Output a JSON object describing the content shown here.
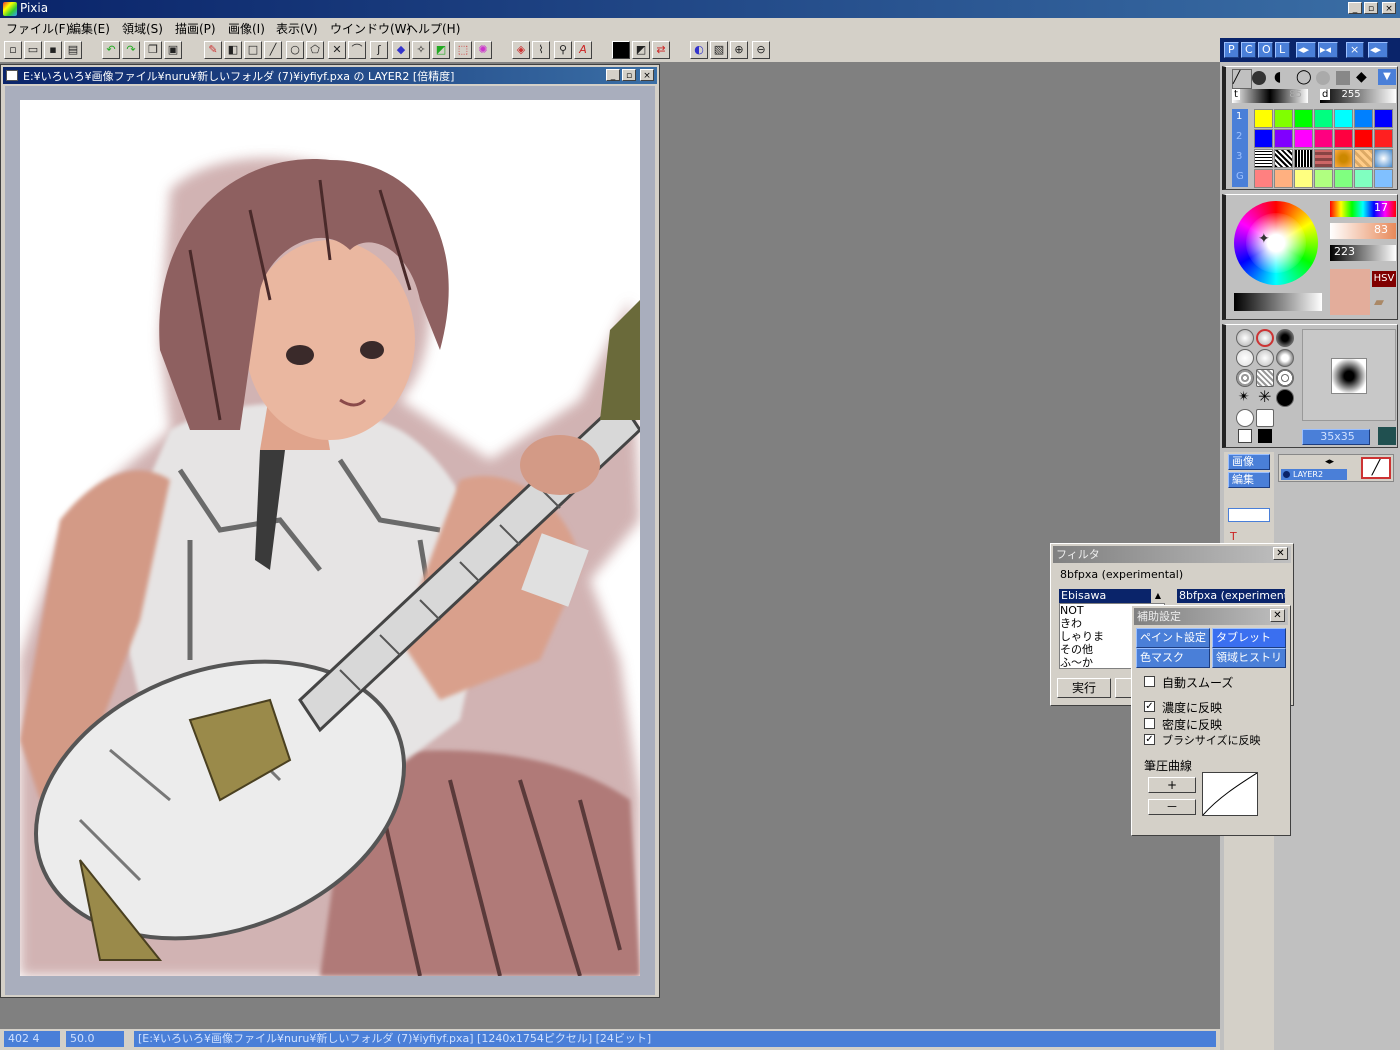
{
  "app": {
    "title": "Pixia",
    "window_buttons": [
      "_",
      "▫",
      "×"
    ]
  },
  "menu": [
    "ファイル(F)",
    "編集(E)",
    "領域(S)",
    "描画(P)",
    "画像(I)",
    "表示(V)",
    "ウインドウ(W)",
    "ヘルプ(H)"
  ],
  "document": {
    "title": "E:¥いろいろ¥画像ファイル¥nuru¥新しいフォルダ (7)¥iyfiyf.pxa の LAYER2 [倍精度]"
  },
  "status": {
    "coords": "402 4",
    "zoom": "50.0",
    "info": "[E:¥いろいろ¥画像ファイル¥nuru¥新しいフォルダ (7)¥iyfiyf.pxa] [1240x1754ピクセル] [24ビット]"
  },
  "panel": {
    "tabs": [
      "P",
      "C",
      "O",
      "L"
    ],
    "nav_icons": [
      "◂▸",
      "▸◂",
      "×",
      "◂▸"
    ],
    "density_label": "t",
    "density_value": "85",
    "size_label": "d",
    "size_value": "255",
    "row_numbers": [
      "1",
      "2",
      "3",
      "G"
    ],
    "palette_row1": [
      "#ffff00",
      "#80ff00",
      "#00ff00",
      "#00ff80",
      "#00ffff",
      "#0080ff",
      "#0000ff"
    ],
    "palette_row2": [
      "#0000ff",
      "#8000ff",
      "#ff00ff",
      "#ff0080",
      "#ff0040",
      "#ff0000",
      "#ff2020"
    ],
    "palette_row4": [
      "#ff8080",
      "#ffb080",
      "#ffff80",
      "#b0ff80",
      "#80ff80",
      "#80ffc0",
      "#80c0ff"
    ],
    "hue_value": "17",
    "sat_value": "83",
    "val_value": "223",
    "color_mode": "HSV",
    "current_color": "#e3ad9b",
    "brush_size": "35x35",
    "image_btn": "画像",
    "edit_btn": "編集",
    "layer_name": "LAYER2"
  },
  "filter_dialog": {
    "title": "フィルタ",
    "plugin": "8bfpxa (experimental)",
    "category_selected": "Ebisawa",
    "filter_selected": "8bfpxa (experiment",
    "list": [
      "NOT",
      "きわ",
      "しゃりま",
      "その他",
      "ふ～か"
    ],
    "run_btn": "実行"
  },
  "settings_dialog": {
    "title": "補助設定",
    "tabs": [
      "ペイント設定",
      "タブレット",
      "色マスク",
      "領域ヒストリ"
    ],
    "auto_smooth": "自動スムーズ",
    "options": [
      {
        "label": "濃度に反映",
        "checked": true
      },
      {
        "label": "密度に反映",
        "checked": false
      },
      {
        "label": "ブラシサイズに反映",
        "checked": true
      }
    ],
    "pressure_curve": "筆圧曲線",
    "plus": "+",
    "minus": "－"
  }
}
